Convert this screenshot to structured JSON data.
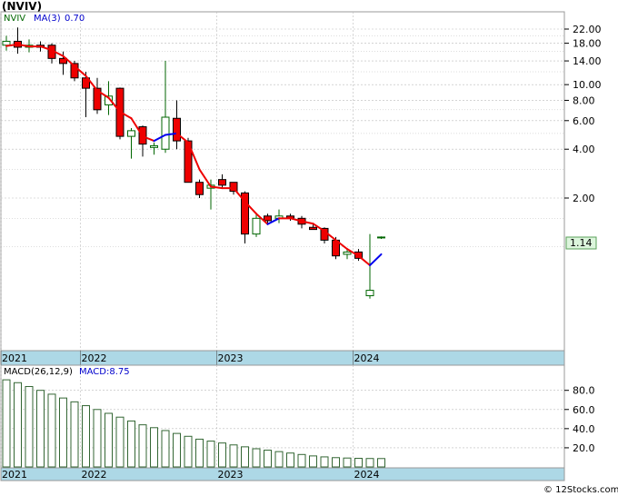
{
  "title": "(NVIV)",
  "legend": {
    "symbol": "NVIV",
    "ma_label": "MA(3)",
    "ma_value": "0.70"
  },
  "last_price_label": "1.14",
  "macd_legend": {
    "label": "MACD(26,12,9)",
    "value_label": "MACD:8.75"
  },
  "footer": "© 12Stocks.com",
  "colors": {
    "up": "#ffffff",
    "down": "#ee0000",
    "ma_down": "#ee0000",
    "ma_up": "#0000ee",
    "grid": "#bbbbbb",
    "axis_band": "#add8e6",
    "macd_bar": "#336633",
    "last_price_box": "#dcf5dc"
  },
  "chart_data": [
    {
      "type": "candlestick",
      "title": "(NVIV)",
      "y_scale": "log",
      "y_ticks": [
        22.0,
        18.0,
        14.0,
        10.0,
        8.0,
        6.0,
        4.0,
        2.0
      ],
      "y_tick_labels": [
        "22.00",
        "18.00",
        "14.00",
        "10.00",
        "8.00",
        "6.00",
        "4.00",
        "2.00"
      ],
      "x_labels": [
        {
          "label": "2021",
          "index": 0
        },
        {
          "label": "2022",
          "index": 7
        },
        {
          "label": "2023",
          "index": 19
        },
        {
          "label": "2024",
          "index": 31
        }
      ],
      "candles": [
        {
          "o": 17.5,
          "h": 20,
          "l": 16.2,
          "c": 18.5
        },
        {
          "o": 18.5,
          "h": 22.5,
          "l": 15.5,
          "c": 17.0
        },
        {
          "o": 17.0,
          "h": 19,
          "l": 15.8,
          "c": 17.5
        },
        {
          "o": 17.5,
          "h": 18.5,
          "l": 16.0,
          "c": 17.0
        },
        {
          "o": 17.5,
          "h": 18,
          "l": 13.5,
          "c": 14.5
        },
        {
          "o": 14.5,
          "h": 16,
          "l": 11.5,
          "c": 13.5
        },
        {
          "o": 13.5,
          "h": 14.0,
          "l": 10.5,
          "c": 11.0
        },
        {
          "o": 11.0,
          "h": 12,
          "l": 6.3,
          "c": 9.5
        },
        {
          "o": 9.5,
          "h": 11,
          "l": 6.6,
          "c": 7.0
        },
        {
          "o": 7.5,
          "h": 10.5,
          "l": 6.5,
          "c": 8.5
        },
        {
          "o": 9.5,
          "h": 9.6,
          "l": 4.6,
          "c": 4.8
        },
        {
          "o": 4.8,
          "h": 5.4,
          "l": 3.5,
          "c": 5.2
        },
        {
          "o": 5.5,
          "h": 5.6,
          "l": 3.6,
          "c": 4.3
        },
        {
          "o": 4.1,
          "h": 4.4,
          "l": 3.7,
          "c": 4.2
        },
        {
          "o": 4.0,
          "h": 14.0,
          "l": 3.8,
          "c": 6.3
        },
        {
          "o": 6.2,
          "h": 8.0,
          "l": 4.0,
          "c": 4.5
        },
        {
          "o": 4.5,
          "h": 4.7,
          "l": 2.5,
          "c": 2.5
        },
        {
          "o": 2.5,
          "h": 2.6,
          "l": 2.0,
          "c": 2.1
        },
        {
          "o": 2.3,
          "h": 2.6,
          "l": 1.7,
          "c": 2.4
        },
        {
          "o": 2.6,
          "h": 2.8,
          "l": 2.3,
          "c": 2.4
        },
        {
          "o": 2.5,
          "h": 2.5,
          "l": 2.1,
          "c": 2.2
        },
        {
          "o": 2.15,
          "h": 2.2,
          "l": 1.05,
          "c": 1.2
        },
        {
          "o": 1.2,
          "h": 1.6,
          "l": 1.15,
          "c": 1.5
        },
        {
          "o": 1.55,
          "h": 1.6,
          "l": 1.4,
          "c": 1.45
        },
        {
          "o": 1.5,
          "h": 1.7,
          "l": 1.4,
          "c": 1.55
        },
        {
          "o": 1.55,
          "h": 1.6,
          "l": 1.45,
          "c": 1.5
        },
        {
          "o": 1.5,
          "h": 1.55,
          "l": 1.3,
          "c": 1.38
        },
        {
          "o": 1.32,
          "h": 1.38,
          "l": 1.28,
          "c": 1.28
        },
        {
          "o": 1.3,
          "h": 1.32,
          "l": 1.05,
          "c": 1.1
        },
        {
          "o": 1.1,
          "h": 1.15,
          "l": 0.84,
          "c": 0.88
        },
        {
          "o": 0.9,
          "h": 0.98,
          "l": 0.84,
          "c": 0.93
        },
        {
          "o": 0.93,
          "h": 0.97,
          "l": 0.82,
          "c": 0.85
        },
        {
          "o": 0.5,
          "h": 1.2,
          "l": 0.48,
          "c": 0.54
        },
        {
          "o": 1.14,
          "h": 1.16,
          "l": 1.12,
          "c": 1.15
        }
      ],
      "ma": [
        17.3,
        17.7,
        17.2,
        17.2,
        16.3,
        15.0,
        13.0,
        11.3,
        9.2,
        8.3,
        6.8,
        6.2,
        4.8,
        4.5,
        4.9,
        5.0,
        4.4,
        3.0,
        2.35,
        2.3,
        2.3,
        1.9,
        1.6,
        1.38,
        1.5,
        1.5,
        1.44,
        1.39,
        1.25,
        1.1,
        0.97,
        0.88,
        0.77,
        0.9
      ],
      "ma_dir": [
        "down",
        "down",
        "down",
        "down",
        "down",
        "down",
        "down",
        "down",
        "down",
        "down",
        "down",
        "down",
        "down",
        "down",
        "up",
        "up",
        "down",
        "down",
        "down",
        "down",
        "down",
        "down",
        "down",
        "down",
        "up",
        "down",
        "down",
        "down",
        "down",
        "down",
        "down",
        "down",
        "down",
        "up"
      ],
      "last_price": 1.14
    },
    {
      "type": "bar",
      "title": "MACD(26,12,9)",
      "y_ticks": [
        80.0,
        60.0,
        40.0,
        20.0
      ],
      "y_tick_labels": [
        "80.0",
        "60.0",
        "40.0",
        "20.0"
      ],
      "x_labels": [
        {
          "label": "2021",
          "index": 0
        },
        {
          "label": "2022",
          "index": 7
        },
        {
          "label": "2023",
          "index": 19
        },
        {
          "label": "2024",
          "index": 31
        }
      ],
      "values": [
        91,
        88,
        84,
        80,
        76,
        72,
        68,
        64,
        60,
        56,
        52,
        48,
        44,
        41,
        38,
        35,
        32,
        29,
        27,
        25,
        23,
        21,
        19,
        17.5,
        16,
        14.5,
        13,
        11.5,
        10.5,
        9.7,
        9.3,
        9.0,
        8.8,
        8.75
      ]
    }
  ]
}
